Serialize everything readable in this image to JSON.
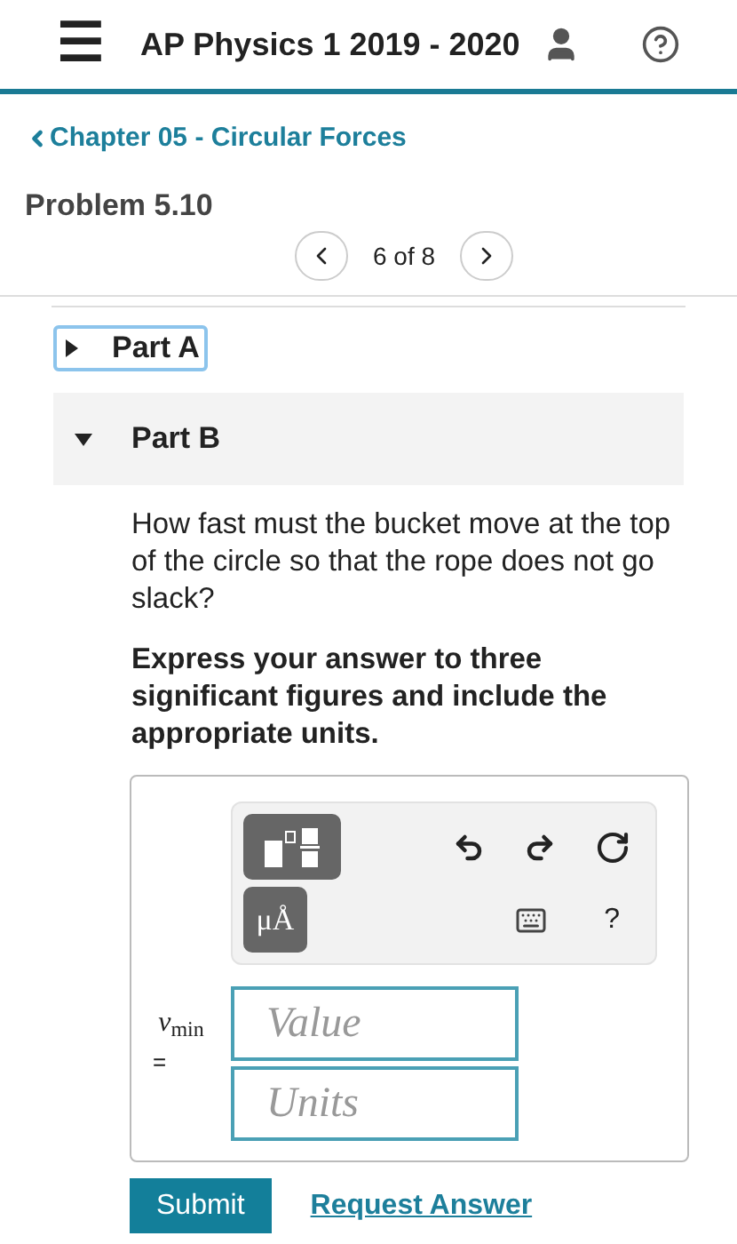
{
  "header": {
    "menu_icon": "☰",
    "title": "AP Physics 1 2019 - 2020"
  },
  "back_link": "Chapter 05 - Circular Forces",
  "problem_title": "Problem 5.10",
  "pager": {
    "position": "6 of 8"
  },
  "parts": [
    {
      "label": "Part A",
      "expanded": false
    },
    {
      "label": "Part B",
      "expanded": true
    }
  ],
  "question": "How fast must the bucket move at the top of the circle so that the rope does not go slack?",
  "instruction": "Express your answer to three significant figures and include the appropriate units.",
  "toolbar": {
    "units_button": "μÅ",
    "help": "?"
  },
  "variable": "*v*$_{min}$",
  "equals": "=",
  "fields": [
    {
      "placeholder": "Value"
    },
    {
      "placeholder": "Units"
    }
  ],
  "buttons": {
    "submit": "Submit",
    "request_answer": "Request Answer"
  }
}
